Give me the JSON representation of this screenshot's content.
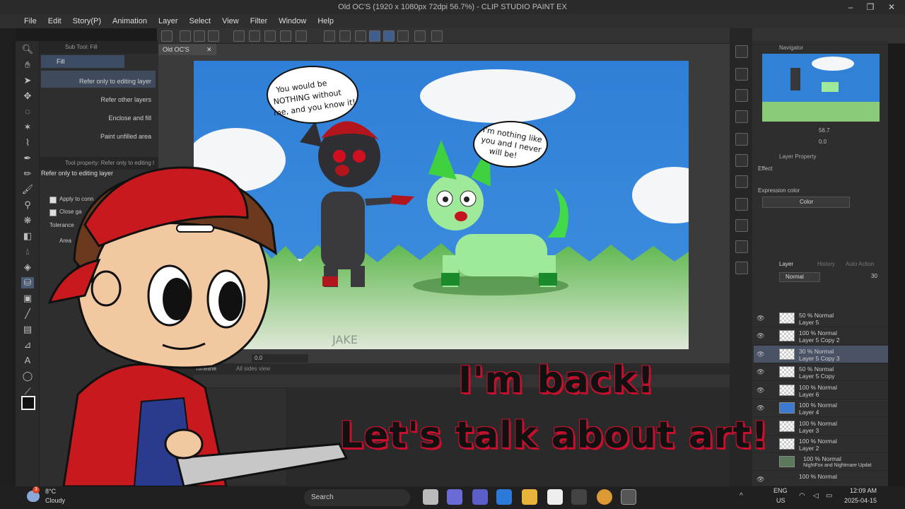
{
  "window": {
    "title": "Old OC'S (1920 x 1080px 72dpi 56.7%) - CLIP STUDIO PAINT EX",
    "controls": [
      "–",
      "❐",
      "✕"
    ]
  },
  "menu": [
    "File",
    "Edit",
    "Story(P)",
    "Animation",
    "Layer",
    "Select",
    "View",
    "Filter",
    "Window",
    "Help"
  ],
  "subtool": {
    "header": "Sub Tool: Fill",
    "group": "Fill",
    "items": [
      "Refer only to editing layer",
      "Refer other layers",
      "Enclose and fill",
      "Paint unfilled area"
    ],
    "property_header": "Tool property: Refer only to editing l",
    "property_title": "Refer only to editing layer",
    "options": [
      "Apply to conn",
      "Close ga",
      "Tolerance",
      "Area"
    ]
  },
  "canvas": {
    "tab": "Old OC'S",
    "zoom": "0.0",
    "bubble1": [
      "You would be",
      "NOTHING without",
      "me, and you know it!"
    ],
    "bubble2": [
      "I'm nothing like",
      "you and I never",
      "will be!"
    ],
    "signature": "JAKE"
  },
  "timeline": {
    "tabs": [
      "Timeline",
      "All sides view"
    ]
  },
  "navigator": {
    "title": "Navigator",
    "zoom": "56.7",
    "angle": "0.0"
  },
  "layer_property": {
    "title": "Layer Property",
    "effect_label": "Effect",
    "expression_label": "Expression color",
    "expression_value": "Color"
  },
  "layers_panel": {
    "tabs": [
      "Layer",
      "History",
      "Auto Action"
    ],
    "blend_mode": "Normal",
    "opacity": "30",
    "layers": [
      {
        "mode": "50 % Normal",
        "name": "Layer 5"
      },
      {
        "mode": "100 % Normal",
        "name": "Layer 5 Copy 2"
      },
      {
        "mode": "30 % Normal",
        "name": "Layer 5 Copy 3"
      },
      {
        "mode": "50 % Normal",
        "name": "Layer 5 Copy"
      },
      {
        "mode": "100 % Normal",
        "name": "Layer 6"
      },
      {
        "mode": "100 % Normal",
        "name": "Layer 4"
      },
      {
        "mode": "100 % Normal",
        "name": "Layer 3"
      },
      {
        "mode": "100 % Normal",
        "name": "Layer 2"
      },
      {
        "mode": "100 % Normal",
        "name": "NightFox and Nightmare Updat"
      },
      {
        "mode": "100 % Normal",
        "name": ""
      }
    ]
  },
  "overlay": {
    "line1": "I'm back!",
    "line2": "Let's talk about art!"
  },
  "taskbar": {
    "temp": "8°C",
    "weather": "Cloudy",
    "weather_badge": "3",
    "search_placeholder": "Search",
    "lang1": "ENG",
    "lang2": "US",
    "time": "12:09 AM",
    "date": "2025-04-15"
  },
  "colors": {
    "sky": "#2f7fd8",
    "grass": "#6fbf5a",
    "red_cap": "#c8191e",
    "panel": "#2e2e2e",
    "selection": "#4a5366"
  }
}
